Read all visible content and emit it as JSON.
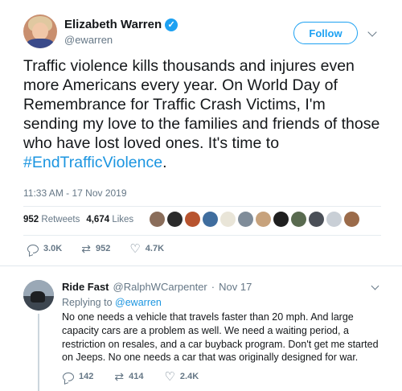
{
  "tweet": {
    "author_name": "Elizabeth Warren",
    "author_handle": "@ewarren",
    "follow_label": "Follow",
    "text_before": "Traffic violence kills thousands and injures even more Americans every year. On World Day of Remembrance for Traffic Crash Victims, I'm sending my love to the families and friends of those who have lost loved ones. It's time to ",
    "hashtag": "#EndTrafficViolence",
    "text_after": ".",
    "timestamp": "11:33 AM - 17 Nov 2019",
    "retweets_count": "952",
    "retweets_label": "Retweets",
    "likes_count": "4,674",
    "likes_label": "Likes",
    "actions": {
      "replies": "3.0K",
      "retweets": "952",
      "likes": "4.7K"
    }
  },
  "reply": {
    "author_name": "Ride Fast",
    "author_handle": "@RalphWCarpenter",
    "separator": "·",
    "date": "Nov 17",
    "replying_to_label": "Replying to",
    "replying_to_handle": "@ewarren",
    "text": "No one needs a vehicle that travels faster than 20 mph.  And large capacity cars are a problem as well. We need a waiting period, a restriction on resales, and a car buyback program.  Don't get me started on Jeeps.  No one needs a car that was originally designed for war.",
    "actions": {
      "replies": "142",
      "retweets": "414",
      "likes": "2.4K"
    }
  },
  "colors": {
    "accent": "#1da1f2",
    "link": "#1b95e0",
    "muted": "#657786",
    "text": "#14171a"
  }
}
